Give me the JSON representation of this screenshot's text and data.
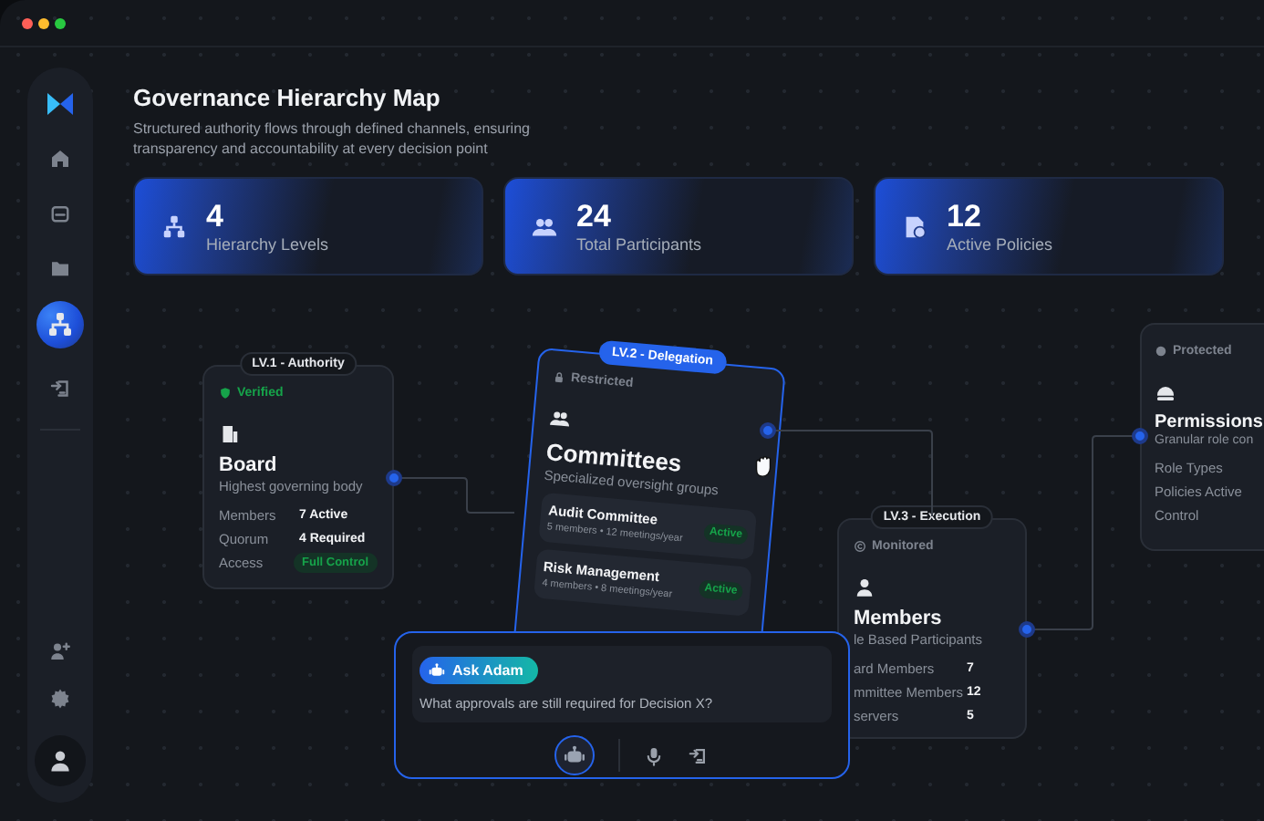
{
  "sidebar": {
    "items": [
      {
        "kind": "home",
        "selected": false
      },
      {
        "kind": "calendar",
        "selected": false
      },
      {
        "kind": "folder",
        "selected": false
      },
      {
        "kind": "hierarchy",
        "selected": true
      },
      {
        "kind": "login",
        "selected": false
      }
    ],
    "bottom_items": [
      {
        "kind": "user-plus",
        "selected": false
      },
      {
        "kind": "settings",
        "selected": false
      }
    ]
  },
  "header": {
    "title": "Governance Hierarchy Map",
    "subtitle": "Structured authority flows through defined channels, ensuring transparency and accountability at every decision point"
  },
  "stats": [
    {
      "kind": "hierarchy",
      "value": "4",
      "label": "Hierarchy Levels"
    },
    {
      "kind": "users",
      "value": "24",
      "label": "Total Participants"
    },
    {
      "kind": "policy",
      "value": "12",
      "label": "Active Policies"
    }
  ],
  "nodes": [
    {
      "kind": "board",
      "level_badge": "LV.1 - Authority",
      "selected": false,
      "status": {
        "kind": "verified",
        "label": "Verified"
      },
      "title": "Board",
      "subtitle": "Highest governing body",
      "fields": [
        {
          "kind": "text",
          "label": "Members",
          "value": "7 Active"
        },
        {
          "kind": "text",
          "label": "Quorum",
          "value": "4 Required"
        },
        {
          "kind": "tag",
          "label": "Access",
          "value": "Full Control"
        }
      ]
    },
    {
      "kind": "committee",
      "level_badge": "LV.2 - Delegation",
      "selected": true,
      "status": {
        "kind": "restricted",
        "label": "Restricted"
      },
      "title": "Committees",
      "subtitle": "Specialized oversight groups",
      "groups": [
        {
          "name": "Audit Committee",
          "detail": "5 members • 12 meetings/year",
          "tag": "Active"
        },
        {
          "name": "Risk Management",
          "detail": "4 members • 8 meetings/year",
          "tag": "Active"
        }
      ]
    },
    {
      "kind": "member",
      "level_badge": "LV.3 - Execution",
      "selected": false,
      "status": {
        "kind": "monitored",
        "label": "Monitored"
      },
      "title": "Members",
      "subtitle": "le Based Participants",
      "fields": [
        {
          "kind": "text",
          "label": "ard Members",
          "value": "7"
        },
        {
          "kind": "text",
          "label": "mmittee Members",
          "value": "12"
        },
        {
          "kind": "text",
          "label": "servers",
          "value": "5"
        }
      ]
    },
    {
      "kind": "permission",
      "selected": false,
      "status": {
        "kind": "protected",
        "label": "Protected"
      },
      "title": "Permissions",
      "subtitle": "Granular role con",
      "fields": [
        {
          "kind": "text",
          "label": "Role Types"
        },
        {
          "kind": "text",
          "label": "Policies Active"
        },
        {
          "kind": "text",
          "label": "Control"
        }
      ]
    }
  ],
  "assistant": {
    "chip": "Ask Adam",
    "question": "What approvals are still required for Decision X?"
  }
}
